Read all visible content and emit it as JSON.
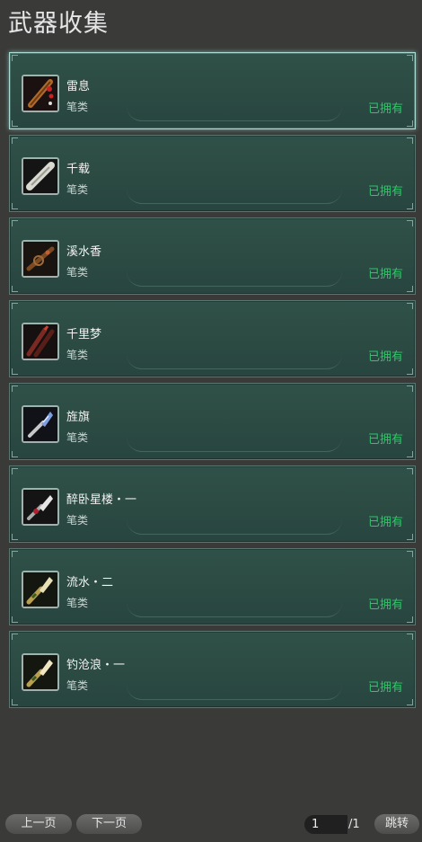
{
  "title": "武器收集",
  "items": [
    {
      "name": "雷息",
      "type": "笔类",
      "status": "已拥有",
      "icon": "red-brush-icon",
      "selected": true
    },
    {
      "name": "千载",
      "type": "笔类",
      "status": "已拥有",
      "icon": "white-brush-icon",
      "selected": false
    },
    {
      "name": "溪水香",
      "type": "笔类",
      "status": "已拥有",
      "icon": "brown-brush-icon",
      "selected": false
    },
    {
      "name": "千里梦",
      "type": "笔类",
      "status": "已拥有",
      "icon": "double-brush-icon",
      "selected": false
    },
    {
      "name": "旌旗",
      "type": "笔类",
      "status": "已拥有",
      "icon": "blue-brush-icon",
      "selected": false
    },
    {
      "name": "醉卧星楼・一",
      "type": "笔类",
      "status": "已拥有",
      "icon": "silver-brush-icon",
      "selected": false
    },
    {
      "name": "流水・二",
      "type": "笔类",
      "status": "已拥有",
      "icon": "gold-brush-icon",
      "selected": false
    },
    {
      "name": "钓沧浪・一",
      "type": "笔类",
      "status": "已拥有",
      "icon": "gold-brush-icon-2",
      "selected": false
    }
  ],
  "pagination": {
    "prev_label": "上一页",
    "next_label": "下一页",
    "current_page": "1",
    "total": "/1",
    "jump_label": "跳转"
  },
  "colors": {
    "owned": "#31c46a",
    "card_bg": "#2d4d45",
    "selected_border": "#a9ddd4"
  }
}
